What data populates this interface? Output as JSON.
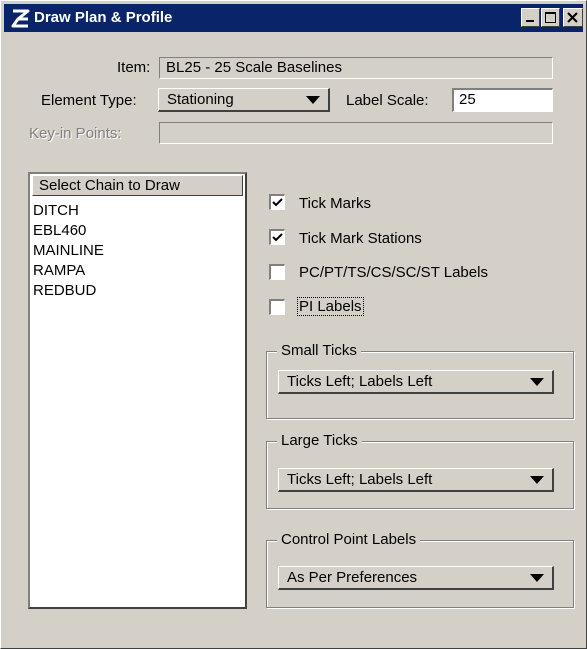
{
  "window": {
    "title": "Draw Plan & Profile"
  },
  "item": {
    "label": "Item:",
    "value": "BL25 - 25 Scale Baselines"
  },
  "element_type": {
    "label": "Element Type:",
    "value": "Stationing"
  },
  "label_scale": {
    "label": "Label Scale:",
    "value": "25"
  },
  "keyin": {
    "label": "Key-in Points:",
    "value": ""
  },
  "chains": {
    "header": "Select Chain to Draw",
    "items": [
      "DITCH",
      "EBL460",
      "MAINLINE",
      "RAMPA",
      "REDBUD"
    ]
  },
  "options": {
    "tick_marks": {
      "label": "Tick Marks",
      "checked": true
    },
    "tick_mark_stations": {
      "label": "Tick Mark Stations",
      "checked": true
    },
    "pc_labels": {
      "label": "PC/PT/TS/CS/SC/ST Labels",
      "checked": false
    },
    "pi_labels": {
      "label": "PI Labels",
      "checked": false
    }
  },
  "small_ticks": {
    "title": "Small Ticks",
    "value": "Ticks Left; Labels Left"
  },
  "large_ticks": {
    "title": "Large Ticks",
    "value": "Ticks Left; Labels Left"
  },
  "control_point_labels": {
    "title": "Control Point Labels",
    "value": "As Per Preferences"
  },
  "colors": {
    "titlebar": "#0a246a",
    "dialog": "#d4d0c8"
  }
}
